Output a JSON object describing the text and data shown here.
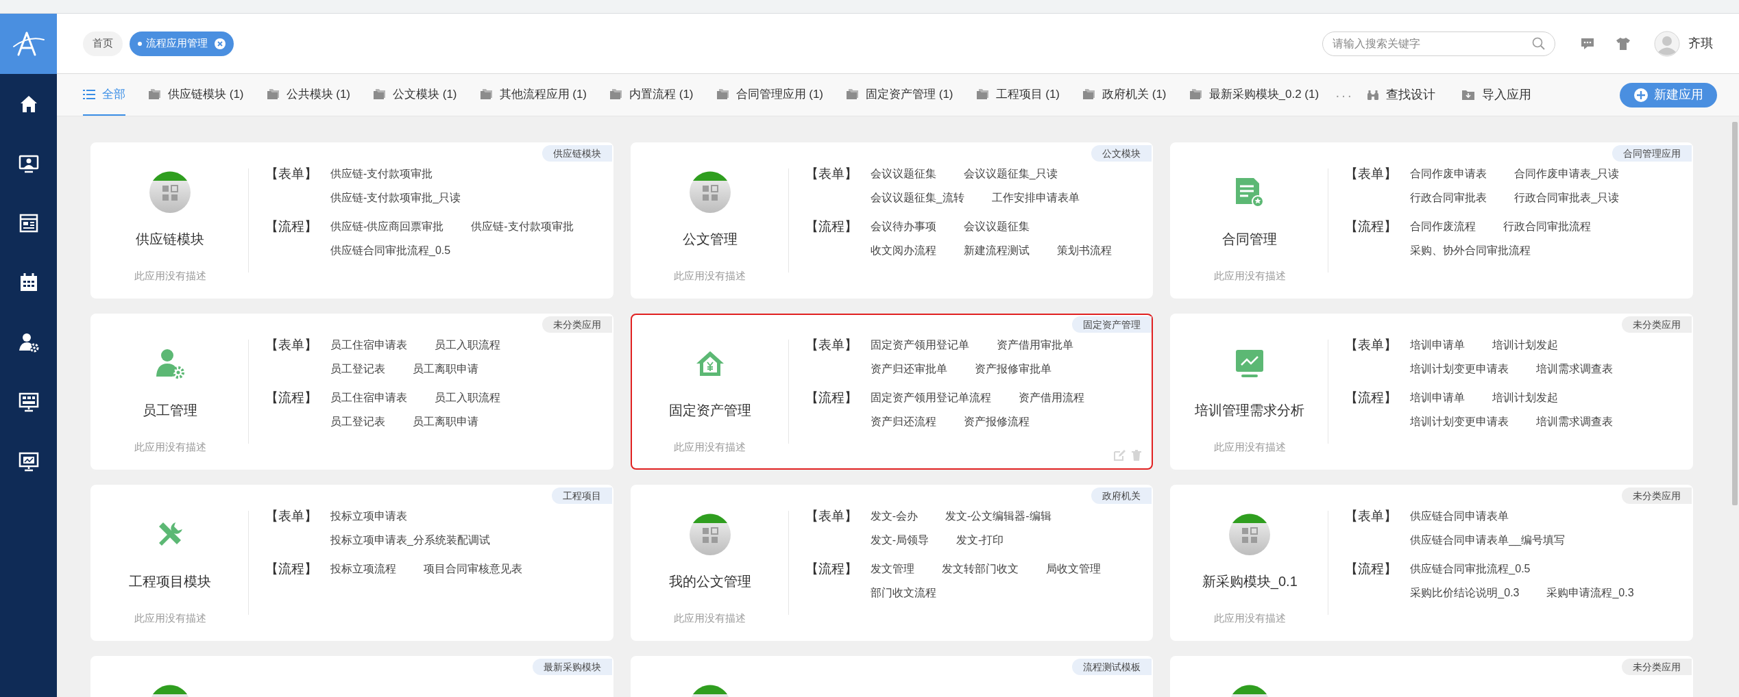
{
  "header": {
    "breadcrumbs": [
      {
        "label": "首页",
        "selected": false
      },
      {
        "label": "流程应用管理",
        "selected": true
      }
    ],
    "search": {
      "placeholder": "请输入搜索关键字"
    },
    "user": {
      "name": "齐琪"
    }
  },
  "sidebar": {
    "items": [
      {
        "kind": "home"
      },
      {
        "kind": "monitor-person"
      },
      {
        "kind": "board"
      },
      {
        "kind": "calendar"
      },
      {
        "kind": "user-gear"
      },
      {
        "kind": "presentation"
      },
      {
        "kind": "monitor-chart"
      }
    ]
  },
  "tabs": [
    {
      "label": "全部",
      "kind": "all",
      "selected": true
    },
    {
      "label": "供应链模块 (1)",
      "kind": "folder",
      "selected": false
    },
    {
      "label": "公共模块 (1)",
      "kind": "folder",
      "selected": false
    },
    {
      "label": "公文模块 (1)",
      "kind": "folder",
      "selected": false
    },
    {
      "label": "其他流程应用 (1)",
      "kind": "folder",
      "selected": false
    },
    {
      "label": "内置流程 (1)",
      "kind": "folder",
      "selected": false
    },
    {
      "label": "合同管理应用 (1)",
      "kind": "folder",
      "selected": false
    },
    {
      "label": "固定资产管理 (1)",
      "kind": "folder",
      "selected": false
    },
    {
      "label": "工程项目 (1)",
      "kind": "folder",
      "selected": false
    },
    {
      "label": "政府机关 (1)",
      "kind": "folder",
      "selected": false
    },
    {
      "label": "最新采购模块_0.2 (1)",
      "kind": "folder",
      "selected": false
    }
  ],
  "toolbar": {
    "more": "···",
    "find": "查找设计",
    "import": "导入应用",
    "create": "新建应用"
  },
  "apps": [
    {
      "tag": "供应链模块",
      "color": "#e8eff9",
      "kind": "grid",
      "title": "供应链模块",
      "description": "此应用没有描述",
      "highlighted": false,
      "sections": [
        {
          "label": "【表单】",
          "rows": [
            [
              "供应链-支付款项审批"
            ],
            [
              "供应链-支付款项审批_只读"
            ]
          ]
        },
        {
          "label": "【流程】",
          "rows": [
            [
              "供应链-供应商回票审批",
              "供应链-支付款项审批"
            ],
            [
              "供应链合同审批流程_0.5"
            ]
          ]
        }
      ]
    },
    {
      "tag": "公文模块",
      "color": "#e8eff9",
      "kind": "grid",
      "title": "公文管理",
      "description": "此应用没有描述",
      "highlighted": false,
      "sections": [
        {
          "label": "【表单】",
          "rows": [
            [
              "会议议题征集",
              "会议议题征集_只读"
            ],
            [
              "会议议题征集_流转",
              "工作安排申请表单"
            ]
          ]
        },
        {
          "label": "【流程】",
          "rows": [
            [
              "会议待办事项",
              "会议议题征集"
            ],
            [
              "收文阅办流程",
              "新建流程测试",
              "策划书流程"
            ]
          ]
        }
      ]
    },
    {
      "tag": "合同管理应用",
      "color": "#e8eff9",
      "kind": "document",
      "title": "合同管理",
      "description": "此应用没有描述",
      "highlighted": false,
      "sections": [
        {
          "label": "【表单】",
          "rows": [
            [
              "合同作废申请表",
              "合同作废申请表_只读"
            ],
            [
              "行政合同审批表",
              "行政合同审批表_只读"
            ]
          ]
        },
        {
          "label": "【流程】",
          "rows": [
            [
              "合同作废流程",
              "行政合同审批流程"
            ],
            [
              "采购、协外合同审批流程"
            ]
          ]
        }
      ]
    },
    {
      "tag": "未分类应用",
      "color": "#eeeeee",
      "kind": "person-gear",
      "title": "员工管理",
      "description": "此应用没有描述",
      "highlighted": false,
      "sections": [
        {
          "label": "【表单】",
          "rows": [
            [
              "员工住宿申请表",
              "员工入职流程"
            ],
            [
              "员工登记表",
              "员工离职申请"
            ]
          ]
        },
        {
          "label": "【流程】",
          "rows": [
            [
              "员工住宿申请表",
              "员工入职流程"
            ],
            [
              "员工登记表",
              "员工离职申请"
            ]
          ]
        }
      ]
    },
    {
      "tag": "固定资产管理",
      "color": "#e8eff9",
      "kind": "house",
      "title": "固定资产管理",
      "description": "此应用没有描述",
      "highlighted": true,
      "sections": [
        {
          "label": "【表单】",
          "rows": [
            [
              "固定资产领用登记单",
              "资产借用审批单"
            ],
            [
              "资产归还审批单",
              "资产报修审批单"
            ]
          ]
        },
        {
          "label": "【流程】",
          "rows": [
            [
              "固定资产领用登记单流程",
              "资产借用流程"
            ],
            [
              "资产归还流程",
              "资产报修流程"
            ]
          ]
        }
      ]
    },
    {
      "tag": "未分类应用",
      "color": "#eeeeee",
      "kind": "chart",
      "title": "培训管理需求分析",
      "description": "此应用没有描述",
      "highlighted": false,
      "sections": [
        {
          "label": "【表单】",
          "rows": [
            [
              "培训申请单",
              "培训计划发起"
            ],
            [
              "培训计划变更申请表",
              "培训需求调查表"
            ]
          ]
        },
        {
          "label": "【流程】",
          "rows": [
            [
              "培训申请单",
              "培训计划发起"
            ],
            [
              "培训计划变更申请表",
              "培训需求调查表"
            ]
          ]
        }
      ]
    },
    {
      "tag": "工程项目",
      "color": "#e8eff9",
      "kind": "tools",
      "title": "工程项目模块",
      "description": "此应用没有描述",
      "highlighted": false,
      "sections": [
        {
          "label": "【表单】",
          "rows": [
            [
              "投标立项申请表"
            ],
            [
              "投标立项申请表_分系统装配调试"
            ]
          ]
        },
        {
          "label": "【流程】",
          "rows": [
            [
              "投标立项流程",
              "项目合同审核意见表"
            ]
          ]
        }
      ]
    },
    {
      "tag": "政府机关",
      "color": "#e8eff9",
      "kind": "grid",
      "title": "我的公文管理",
      "description": "此应用没有描述",
      "highlighted": false,
      "sections": [
        {
          "label": "【表单】",
          "rows": [
            [
              "发文-会办",
              "发文-公文编辑器-编辑"
            ],
            [
              "发文-局领导",
              "发文-打印"
            ]
          ]
        },
        {
          "label": "【流程】",
          "rows": [
            [
              "发文管理",
              "发文转部门收文",
              "局收文管理"
            ],
            [
              "部门收文流程"
            ]
          ]
        }
      ]
    },
    {
      "tag": "未分类应用",
      "color": "#eeeeee",
      "kind": "grid",
      "title": "新采购模块_0.1",
      "description": "此应用没有描述",
      "highlighted": false,
      "sections": [
        {
          "label": "【表单】",
          "rows": [
            [
              "供应链合同申请表单"
            ],
            [
              "供应链合同申请表单__编号填写"
            ]
          ]
        },
        {
          "label": "【流程】",
          "rows": [
            [
              "供应链合同审批流程_0.5"
            ],
            [
              "采购比价结论说明_0.3",
              "采购申请流程_0.3"
            ]
          ]
        }
      ]
    },
    {
      "tag": "最新采购模块",
      "color": "#e8eff9",
      "kind": "grid",
      "highlighted": false
    },
    {
      "tag": "流程测试模板",
      "color": "#e8eff9",
      "kind": "grid",
      "highlighted": false
    },
    {
      "tag": "未分类应用",
      "color": "#eeeeee",
      "kind": "grid",
      "highlighted": false
    }
  ]
}
